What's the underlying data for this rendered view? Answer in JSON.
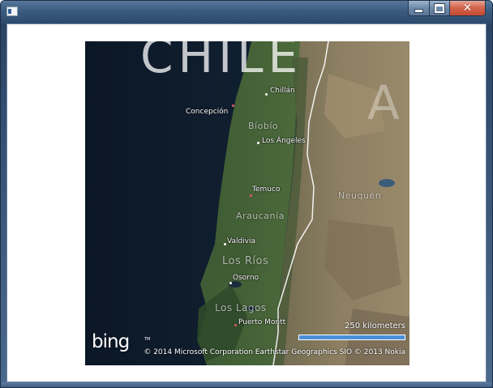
{
  "window": {
    "title": "",
    "icon": "app-window-icon",
    "buttons": {
      "minimize": "minimize-icon",
      "maximize": "maximize-icon",
      "close_glyph": "✕"
    }
  },
  "map": {
    "provider_logo": "bing",
    "provider_tm": "TM",
    "country_labels": [
      "CHILE",
      "A"
    ],
    "cities": [
      "Chillán",
      "Concepción",
      "Los Ángeles",
      "Temuco",
      "Valdivia",
      "Osorno",
      "Puerto Montt"
    ],
    "regions": [
      "Bíobío",
      "Neuquén",
      "Araucanía",
      "Los Ríos",
      "Los Lagos"
    ],
    "scale_label": "250 kilometers",
    "copyright": "© 2014 Microsoft Corporation    Earthstar Geographics  SIO    © 2013 Nokia",
    "colors": {
      "ocean": "#0d1b2a",
      "land_green": "#3c5a2e",
      "land_brown": "#8a7a5e",
      "border_line": "#ffffff",
      "scale_fill": "#4a8fd8"
    }
  }
}
